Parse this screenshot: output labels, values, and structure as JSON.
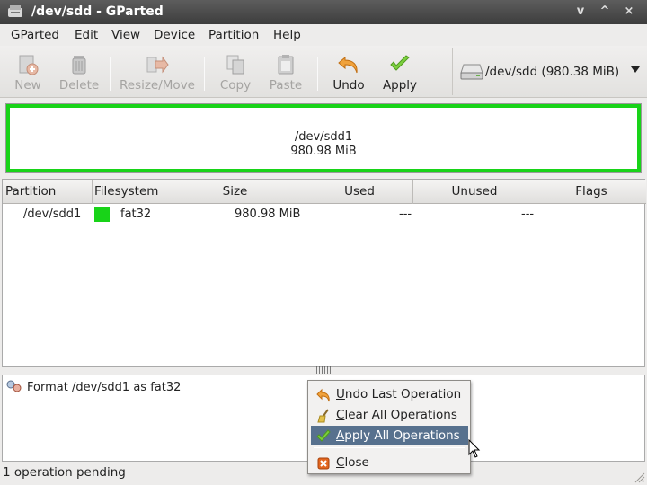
{
  "window": {
    "title": "/dev/sdd - GParted",
    "controls": [
      "v",
      "^",
      "×"
    ]
  },
  "menubar": {
    "items": [
      "GParted",
      "Edit",
      "View",
      "Device",
      "Partition",
      "Help"
    ]
  },
  "toolbar": {
    "new": "New",
    "delete": "Delete",
    "resize_move": "Resize/Move",
    "copy": "Copy",
    "paste": "Paste",
    "undo": "Undo",
    "apply": "Apply",
    "device": "/dev/sdd   (980.38 MiB)"
  },
  "graphic": {
    "partition_name": "/dev/sdd1",
    "partition_size": "980.98 MiB",
    "border_color": "#18d318"
  },
  "table": {
    "columns": [
      "Partition",
      "Filesystem",
      "Size",
      "Used",
      "Unused",
      "Flags"
    ],
    "rows": [
      {
        "partition": "/dev/sdd1",
        "filesystem": "fat32",
        "fs_color": "#18d318",
        "size": "980.98 MiB",
        "used": "---",
        "unused": "---",
        "flags": ""
      }
    ]
  },
  "splitter": {
    "grip": "||||||"
  },
  "operations": {
    "items": [
      "Format /dev/sdd1 as fat32"
    ]
  },
  "context_menu": {
    "undo_last": "Undo Last Operation",
    "clear_all": "Clear All Operations",
    "apply_all": "Apply All Operations",
    "close": "Close",
    "highlight_color": "#57718e"
  },
  "status": {
    "text": "1 operation pending"
  }
}
